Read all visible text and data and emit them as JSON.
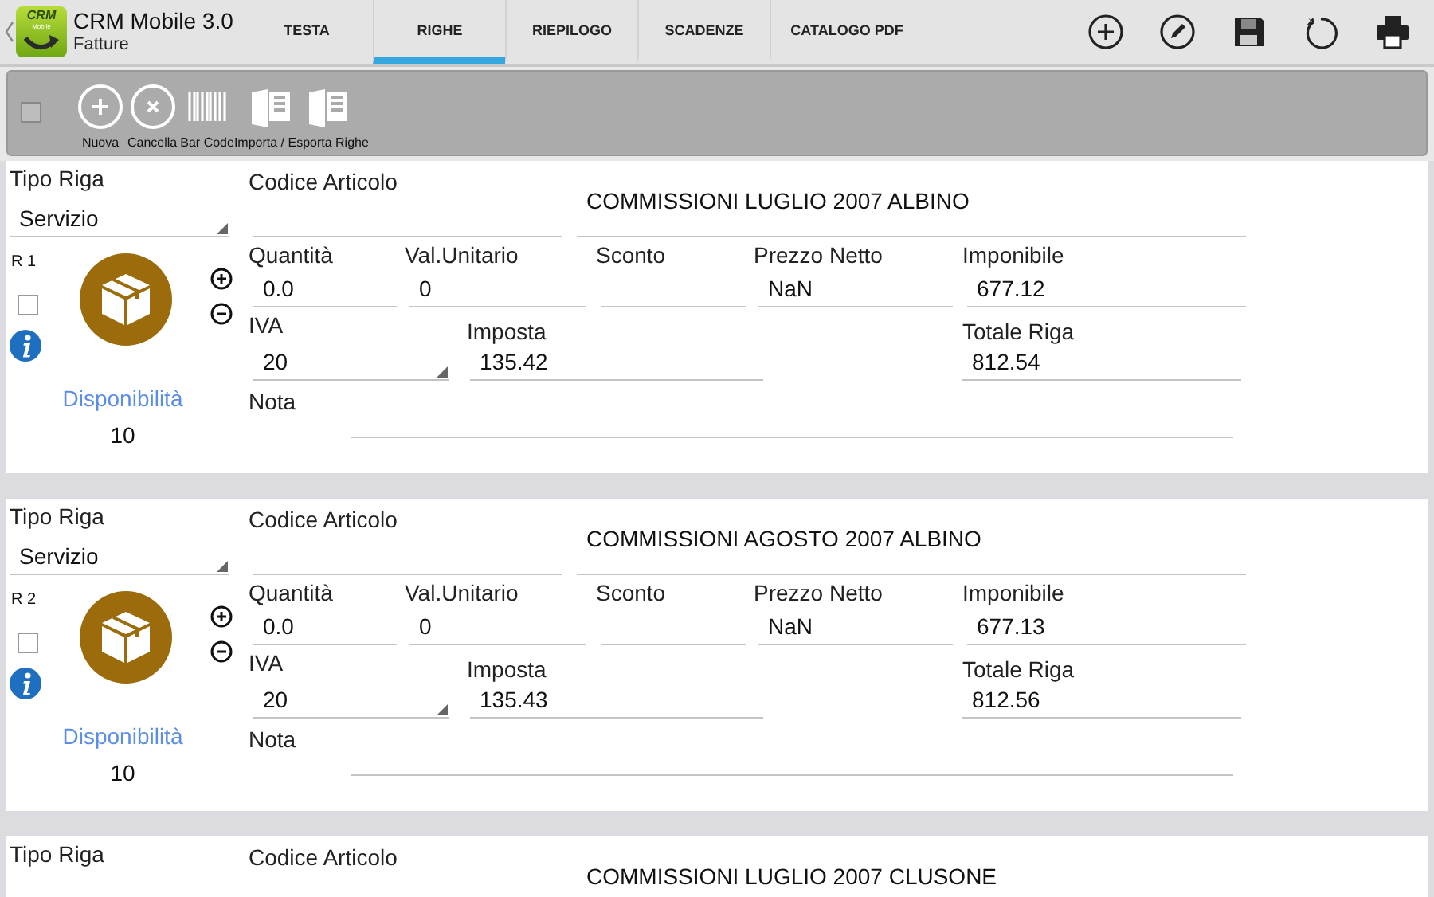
{
  "app": {
    "logo_text": "CRM",
    "logo_subtext": "Mobile",
    "title": "CRM Mobile 3.0",
    "subtitle": "Fatture"
  },
  "tabs": [
    {
      "label": "TESTA",
      "selected": false
    },
    {
      "label": "RIGHE",
      "selected": true
    },
    {
      "label": "RIEPILOGO",
      "selected": false
    },
    {
      "label": "SCADENZE",
      "selected": false
    },
    {
      "label": "CATALOGO PDF",
      "selected": false
    }
  ],
  "actions": [
    {
      "kind": "add"
    },
    {
      "kind": "edit"
    },
    {
      "kind": "save"
    },
    {
      "kind": "undo"
    },
    {
      "kind": "print"
    }
  ],
  "toolbar": {
    "checked": false,
    "buttons": [
      {
        "kind": "add",
        "label": "Nuova"
      },
      {
        "kind": "cancel",
        "label": "Cancella"
      },
      {
        "kind": "barcode",
        "label": "Bar Code"
      },
      {
        "kind": "excel",
        "label": "Importa / Esporta Righe"
      }
    ]
  },
  "rows": [
    {
      "tipo_riga_label": "Tipo Riga",
      "tipo_riga": "Servizio",
      "codice_label": "Codice Articolo",
      "descrizione": "COMMISSIONI LUGLIO 2007 ALBINO",
      "row_label": "R 1",
      "checked": false,
      "availability_label": "Disponibilità",
      "availability": "10",
      "nota_label": "Nota",
      "fields": [
        {
          "kind": "text",
          "label": "Quantità",
          "value": "0.0"
        },
        {
          "kind": "text",
          "label": "Val.Unitario",
          "value": "0"
        },
        {
          "kind": "text",
          "label": "Sconto"
        },
        {
          "kind": "text",
          "label": "Prezzo Netto",
          "value": "NaN"
        },
        {
          "kind": "text",
          "label": "Imponibile",
          "value": "677.12"
        },
        {
          "kind": "select",
          "label": "IVA",
          "value": "20"
        },
        {
          "kind": "text",
          "label": "Imposta",
          "value": "135.42"
        },
        {
          "kind": "text",
          "label": "Totale Riga",
          "value": "812.54"
        }
      ]
    },
    {
      "tipo_riga_label": "Tipo Riga",
      "tipo_riga": "Servizio",
      "codice_label": "Codice Articolo",
      "descrizione": "COMMISSIONI AGOSTO 2007 ALBINO",
      "row_label": "R 2",
      "checked": false,
      "availability_label": "Disponibilità",
      "availability": "10",
      "nota_label": "Nota",
      "fields": [
        {
          "kind": "text",
          "label": "Quantità",
          "value": "0.0"
        },
        {
          "kind": "text",
          "label": "Val.Unitario",
          "value": "0"
        },
        {
          "kind": "text",
          "label": "Sconto"
        },
        {
          "kind": "text",
          "label": "Prezzo Netto",
          "value": "NaN"
        },
        {
          "kind": "text",
          "label": "Imponibile",
          "value": "677.13"
        },
        {
          "kind": "select",
          "label": "IVA",
          "value": "20"
        },
        {
          "kind": "text",
          "label": "Imposta",
          "value": "135.43"
        },
        {
          "kind": "text",
          "label": "Totale Riga",
          "value": "812.56"
        }
      ]
    },
    {
      "tipo_riga_label": "Tipo Riga",
      "codice_label": "Codice Articolo",
      "descrizione": "COMMISSIONI LUGLIO 2007 CLUSONE"
    }
  ]
}
